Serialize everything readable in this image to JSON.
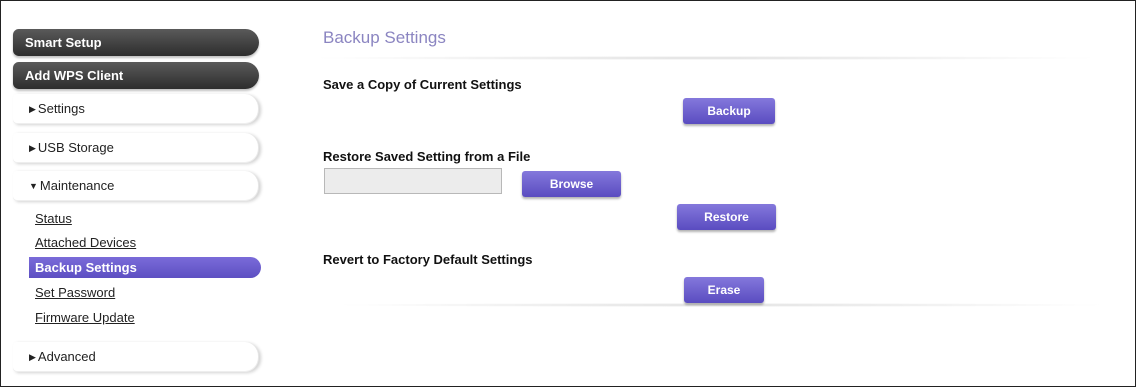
{
  "sidebar": {
    "smart_setup": "Smart Setup",
    "add_wps_client": "Add WPS Client",
    "settings": {
      "arrow": "▶",
      "label": "Settings"
    },
    "usb_storage": {
      "arrow": "▶",
      "label": "USB Storage"
    },
    "maintenance": {
      "arrow": "▼",
      "label": "Maintenance"
    },
    "maintenance_items": [
      {
        "label": "Status"
      },
      {
        "label": "Attached Devices"
      },
      {
        "label": "Backup Settings",
        "active": true
      },
      {
        "label": "Set Password"
      },
      {
        "label": "Firmware Update"
      }
    ],
    "advanced": {
      "arrow": "▶",
      "label": "Advanced"
    }
  },
  "main": {
    "title": "Backup Settings",
    "save_copy": {
      "label": "Save a Copy of Current Settings",
      "button": "Backup"
    },
    "restore": {
      "label": "Restore Saved Setting from a File",
      "file_value": "",
      "browse_button": "Browse",
      "restore_button": "Restore"
    },
    "factory": {
      "label": "Revert to Factory Default Settings",
      "button": "Erase"
    }
  },
  "colors": {
    "accent_purple": "#6a5cd0",
    "title_purple": "#8b85c1",
    "dark_pill": "#3a3a3a"
  }
}
